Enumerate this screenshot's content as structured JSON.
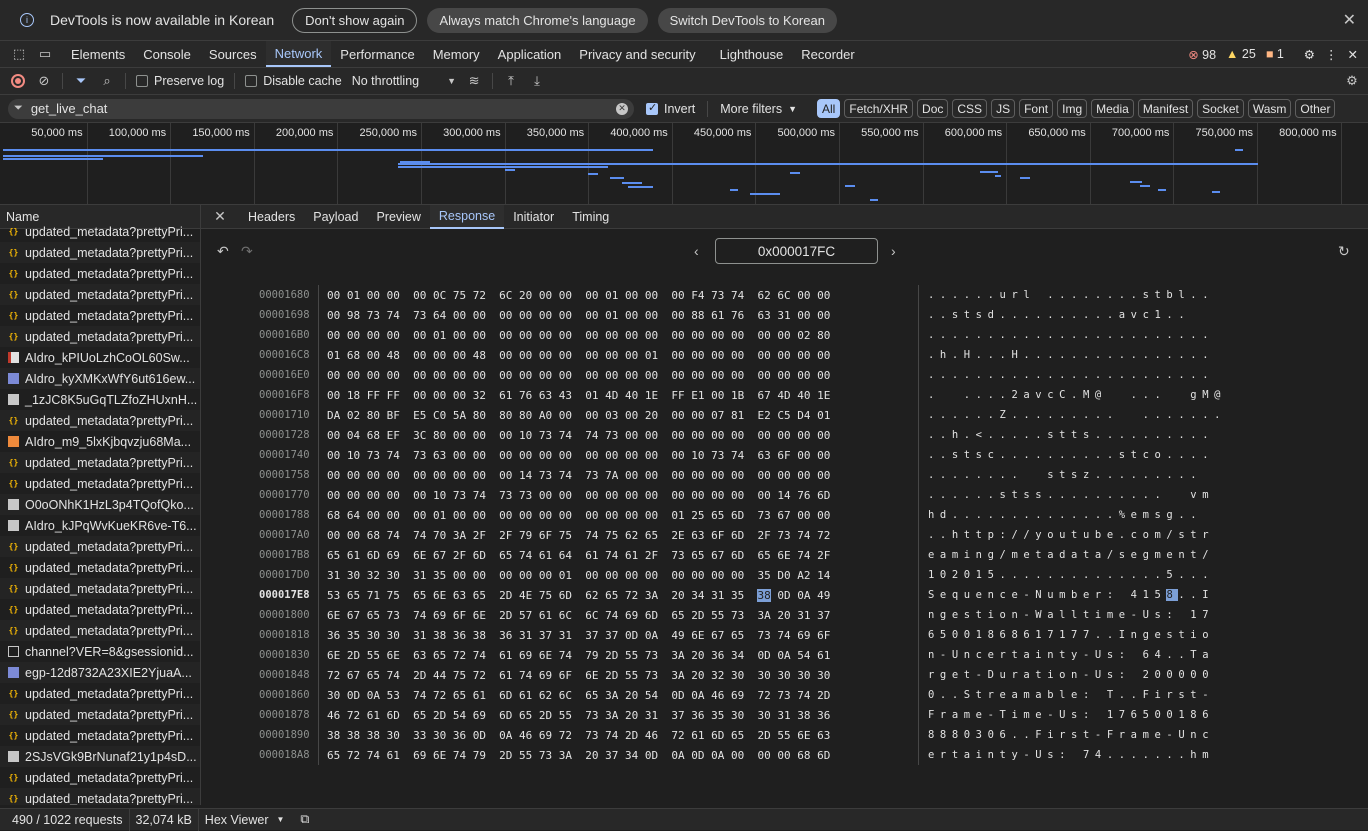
{
  "infobar": {
    "message": "DevTools is now available in Korean",
    "btn_dont_show": "Don't show again",
    "btn_match": "Always match Chrome's language",
    "btn_switch": "Switch DevTools to Korean"
  },
  "tabs": [
    "Elements",
    "Console",
    "Sources",
    "Network",
    "Performance",
    "Memory",
    "Application",
    "Privacy and security",
    "Lighthouse",
    "Recorder"
  ],
  "counters": {
    "errors": "98",
    "warnings": "25",
    "issues": "1"
  },
  "toolbar": {
    "preserve_log": "Preserve log",
    "disable_cache": "Disable cache",
    "throttling": "No throttling"
  },
  "filter": {
    "value": "get_live_chat",
    "invert": "Invert",
    "more_filters": "More filters",
    "types": [
      "All",
      "Fetch/XHR",
      "Doc",
      "CSS",
      "JS",
      "Font",
      "Img",
      "Media",
      "Manifest",
      "Socket",
      "Wasm",
      "Other"
    ]
  },
  "overview": {
    "ticks": [
      "50,000 ms",
      "100,000 ms",
      "150,000 ms",
      "200,000 ms",
      "250,000 ms",
      "300,000 ms",
      "350,000 ms",
      "400,000 ms",
      "450,000 ms",
      "500,000 ms",
      "550,000 ms",
      "600,000 ms",
      "650,000 ms",
      "700,000 ms",
      "750,000 ms",
      "800,000 ms"
    ]
  },
  "requests": {
    "header": "Name",
    "items": [
      {
        "name": "updated_metadata?prettyPri...",
        "icon": "code"
      },
      {
        "name": "updated_metadata?prettyPri...",
        "icon": "code"
      },
      {
        "name": "updated_metadata?prettyPri...",
        "icon": "code"
      },
      {
        "name": "updated_metadata?prettyPri...",
        "icon": "code"
      },
      {
        "name": "updated_metadata?prettyPri...",
        "icon": "code"
      },
      {
        "name": "updated_metadata?prettyPri...",
        "icon": "code"
      },
      {
        "name": "AIdro_kPIUoLzhCoOL60Sw...",
        "icon": "red"
      },
      {
        "name": "AIdro_kyXMKxWfY6ut616ew...",
        "icon": "blue"
      },
      {
        "name": "_1zJC8K5uGqTLZfoZHUxnH...",
        "icon": "img"
      },
      {
        "name": "updated_metadata?prettyPri...",
        "icon": "code"
      },
      {
        "name": "AIdro_m9_5lxKjbqvzju68Ma...",
        "icon": "vid"
      },
      {
        "name": "updated_metadata?prettyPri...",
        "icon": "code"
      },
      {
        "name": "updated_metadata?prettyPri...",
        "icon": "code"
      },
      {
        "name": "O0oONhK1HzL3p4TQofQko...",
        "icon": "img"
      },
      {
        "name": "AIdro_kJPqWvKueKR6ve-T6...",
        "icon": "img"
      },
      {
        "name": "updated_metadata?prettyPri...",
        "icon": "code"
      },
      {
        "name": "updated_metadata?prettyPri...",
        "icon": "code"
      },
      {
        "name": "updated_metadata?prettyPri...",
        "icon": "code"
      },
      {
        "name": "updated_metadata?prettyPri...",
        "icon": "code"
      },
      {
        "name": "updated_metadata?prettyPri...",
        "icon": "code"
      },
      {
        "name": "channel?VER=8&gsessionid...",
        "icon": "doc"
      },
      {
        "name": "egp-12d8732A23XIE2YjuaA...",
        "icon": "blue"
      },
      {
        "name": "updated_metadata?prettyPri...",
        "icon": "code"
      },
      {
        "name": "updated_metadata?prettyPri...",
        "icon": "code"
      },
      {
        "name": "updated_metadata?prettyPri...",
        "icon": "code"
      },
      {
        "name": "2SJsVGk9BrNunaf21y1p4sD...",
        "icon": "img"
      },
      {
        "name": "updated_metadata?prettyPri...",
        "icon": "code"
      },
      {
        "name": "updated_metadata?prettyPri...",
        "icon": "code"
      }
    ]
  },
  "detail_tabs": [
    "Headers",
    "Payload",
    "Preview",
    "Response",
    "Initiator",
    "Timing"
  ],
  "hex": {
    "address": "0x000017FC",
    "rows": [
      {
        "addr": "00001680",
        "bytes": "00 01 00 00  00 0C 75 72  6C 20 00 00  00 01 00 00  00 F4 73 74  62 6C 00 00",
        "ascii": "......url ........stbl.."
      },
      {
        "addr": "00001698",
        "bytes": "00 98 73 74  73 64 00 00  00 00 00 00  00 01 00 00  00 88 61 76  63 31 00 00",
        "ascii": "..stsd..........avc1.."
      },
      {
        "addr": "000016B0",
        "bytes": "00 00 00 00  00 01 00 00  00 00 00 00  00 00 00 00  00 00 00 00  00 00 02 80",
        "ascii": "........................"
      },
      {
        "addr": "000016C8",
        "bytes": "01 68 00 48  00 00 00 48  00 00 00 00  00 00 00 01  00 00 00 00  00 00 00 00",
        "ascii": ".h.H...H................"
      },
      {
        "addr": "000016E0",
        "bytes": "00 00 00 00  00 00 00 00  00 00 00 00  00 00 00 00  00 00 00 00  00 00 00 00",
        "ascii": "........................"
      },
      {
        "addr": "000016F8",
        "bytes": "00 18 FF FF  00 00 00 32  61 76 63 43  01 4D 40 1E  FF E1 00 1B  67 4D 40 1E",
        "ascii": ".  ....2avcC.M@  ...  gM@"
      },
      {
        "addr": "00001710",
        "bytes": "DA 02 80 BF  E5 C0 5A 80  80 80 A0 00  00 03 00 20  00 00 07 81  E2 C5 D4 01",
        "ascii": "......Z.........  ......."
      },
      {
        "addr": "00001728",
        "bytes": "00 04 68 EF  3C 80 00 00  00 10 73 74  74 73 00 00  00 00 00 00  00 00 00 00",
        "ascii": "..h.<.....stts.........."
      },
      {
        "addr": "00001740",
        "bytes": "00 10 73 74  73 63 00 00  00 00 00 00  00 00 00 00  00 10 73 74  63 6F 00 00",
        "ascii": "..stsc..........stco...."
      },
      {
        "addr": "00001758",
        "bytes": "00 00 00 00  00 00 00 00  00 14 73 74  73 7A 00 00  00 00 00 00  00 00 00 00",
        "ascii": "........  stsz........."
      },
      {
        "addr": "00001770",
        "bytes": "00 00 00 00  00 10 73 74  73 73 00 00  00 00 00 00  00 00 00 00  00 14 76 6D",
        "ascii": "......stss..........  vm"
      },
      {
        "addr": "00001788",
        "bytes": "68 64 00 00  00 01 00 00  00 00 00 00  00 00 00 00  01 25 65 6D  73 67 00 00",
        "ascii": "hd..............%emsg.."
      },
      {
        "addr": "000017A0",
        "bytes": "00 00 68 74  74 70 3A 2F  2F 79 6F 75  74 75 62 65  2E 63 6F 6D  2F 73 74 72",
        "ascii": "..http://youtube.com/str"
      },
      {
        "addr": "000017B8",
        "bytes": "65 61 6D 69  6E 67 2F 6D  65 74 61 64  61 74 61 2F  73 65 67 6D  65 6E 74 2F",
        "ascii": "eaming/metadata/segment/"
      },
      {
        "addr": "000017D0",
        "bytes": "31 30 32 30  31 35 00 00  00 00 00 01  00 00 00 00  00 00 00 00  35 D0 A2 14",
        "ascii": "102015..............5..."
      },
      {
        "addr": "000017E8",
        "bytes": "53 65 71 75  65 6E 63 65  2D 4E 75 6D  62 65 72 3A  20 34 31 35  38 0D 0A 49",
        "ascii": "Sequence-Number: 4158..I",
        "current": true
      },
      {
        "addr": "00001800",
        "bytes": "6E 67 65 73  74 69 6F 6E  2D 57 61 6C  6C 74 69 6D  65 2D 55 73  3A 20 31 37",
        "ascii": "ngestion-Walltime-Us: 17"
      },
      {
        "addr": "00001818",
        "bytes": "36 35 30 30  31 38 36 38  36 31 37 31  37 37 0D 0A  49 6E 67 65  73 74 69 6F",
        "ascii": "65001868617177..Ingestio"
      },
      {
        "addr": "00001830",
        "bytes": "6E 2D 55 6E  63 65 72 74  61 69 6E 74  79 2D 55 73  3A 20 36 34  0D 0A 54 61",
        "ascii": "n-Uncertainty-Us: 64..Ta"
      },
      {
        "addr": "00001848",
        "bytes": "72 67 65 74  2D 44 75 72  61 74 69 6F  6E 2D 55 73  3A 20 32 30  30 30 30 30",
        "ascii": "rget-Duration-Us: 200000"
      },
      {
        "addr": "00001860",
        "bytes": "30 0D 0A 53  74 72 65 61  6D 61 62 6C  65 3A 20 54  0D 0A 46 69  72 73 74 2D",
        "ascii": "0..Streamable: T..First-"
      },
      {
        "addr": "00001878",
        "bytes": "46 72 61 6D  65 2D 54 69  6D 65 2D 55  73 3A 20 31  37 36 35 30  30 31 38 36",
        "ascii": "Frame-Time-Us: 176500186"
      },
      {
        "addr": "00001890",
        "bytes": "38 38 38 30  33 30 36 0D  0A 46 69 72  73 74 2D 46  72 61 6D 65  2D 55 6E 63",
        "ascii": "8880306..First-Frame-Unc"
      },
      {
        "addr": "000018A8",
        "bytes": "65 72 74 61  69 6E 74 79  2D 55 73 3A  20 37 34 0D  0A 0D 0A 00  00 00 68 6D",
        "ascii": "ertainty-Us: 74.......hm"
      }
    ]
  },
  "status": {
    "requests": "490 / 1022 requests",
    "size": "32,074 kB",
    "viewer": "Hex Viewer"
  }
}
